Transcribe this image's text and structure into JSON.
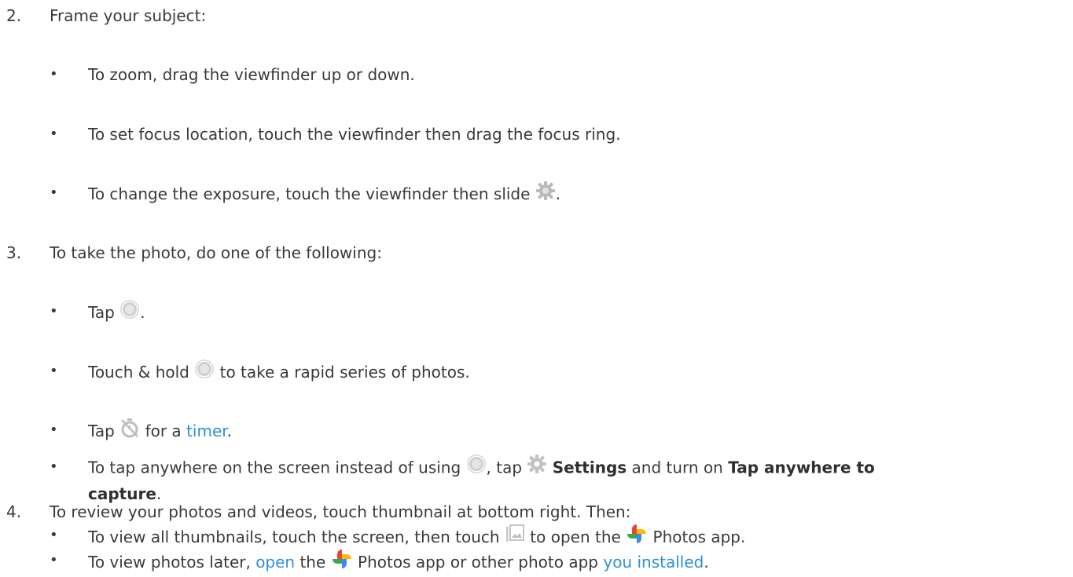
{
  "steps": [
    {
      "number": "2.",
      "text": "Frame your subject:",
      "bullets": [
        {
          "text": "To zoom, drag the viewfinder up or down."
        },
        {
          "text": "To set focus location, touch the viewfinder then drag the focus ring."
        },
        {
          "before": "To change the exposure, touch the viewfinder then slide",
          "icon": "exposure-gear-icon",
          "after": "."
        }
      ]
    },
    {
      "number": "3.",
      "text": "To take the photo, do one of the following:",
      "bullets": [
        {
          "before": "Tap",
          "icon": "shutter-icon",
          "after": "."
        },
        {
          "before": "Touch & hold",
          "icon": "shutter-icon",
          "after": "to take a rapid series of photos."
        },
        {
          "before": "Tap",
          "icon": "timer-off-icon",
          "middle": "for a",
          "link": "timer",
          "after": "."
        },
        {
          "before": "To tap anywhere on the screen instead of using",
          "icon": "shutter-icon",
          "middle": ", tap",
          "icon2": "settings-gear-icon",
          "bold1": "Settings",
          "middle2": "and turn on",
          "bold2a": "Tap anywhere to",
          "bold2b": "capture",
          "after": "."
        }
      ]
    },
    {
      "number": "4.",
      "text": "To review your photos and videos, touch thumbnail at bottom right. Then:",
      "bullets": [
        {
          "before": "To view all thumbnails, touch the screen, then touch",
          "icon": "gallery-icon",
          "middle": "to open the",
          "icon2": "google-photos-icon",
          "after": "Photos app."
        },
        {
          "before": "To view photos later,",
          "link": "open",
          "middle": "the",
          "icon": "google-photos-icon",
          "middle2": "Photos app or other photo app",
          "link2": "you installed",
          "after": "."
        }
      ]
    }
  ],
  "bullet_char": "•",
  "colors": {
    "text": "#3a3a3a",
    "link": "#2e8fd8",
    "icon_gray": "#b5b5b5"
  }
}
